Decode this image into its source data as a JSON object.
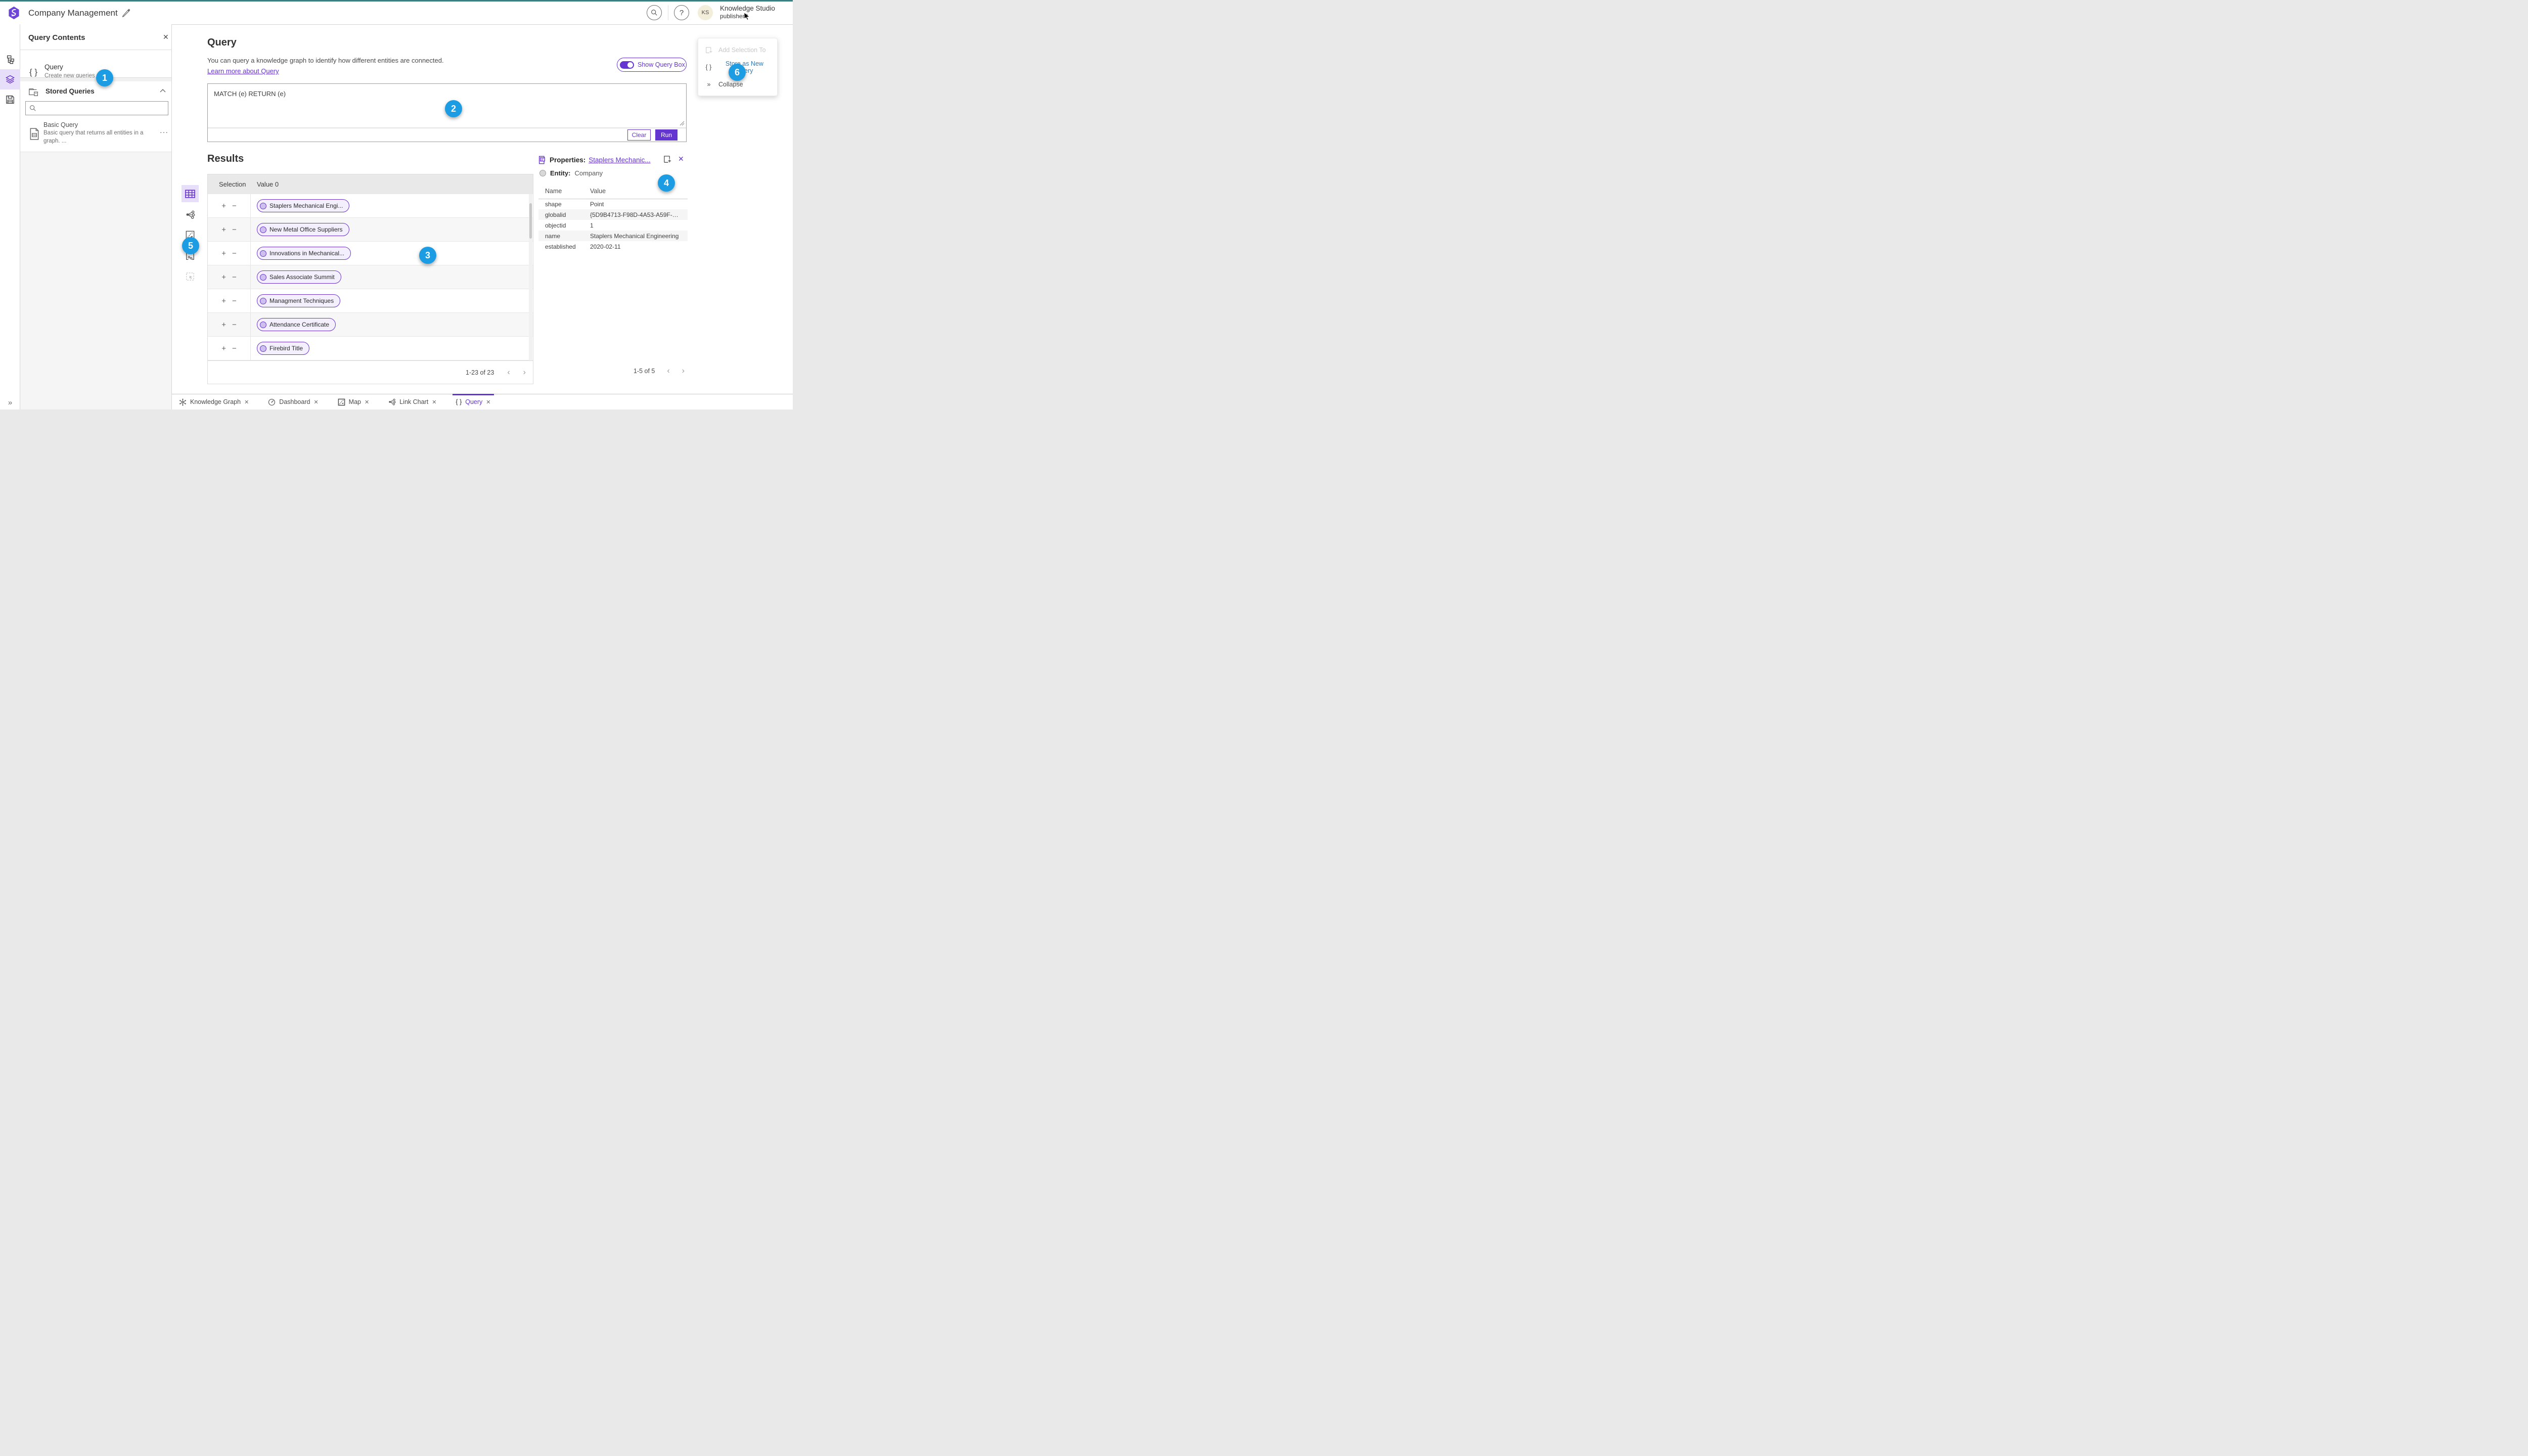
{
  "colors": {
    "accent": "#6535d2",
    "badge_blue": "#1b9ce3",
    "teal_strip": "#3b7f80",
    "link_blue": "#3178b6"
  },
  "glyphs": {
    "close": "✕",
    "plus": "+",
    "minus": "−",
    "prev": "‹",
    "next": "›",
    "ellipsis": "···",
    "braces": "{ }",
    "double_chevron": "»",
    "help": "?"
  },
  "header": {
    "app_title": "Company Management",
    "product_name": "Knowledge Studio",
    "user_name": "publisher2",
    "avatar_initials": "KS"
  },
  "query_contents": {
    "title": "Query Contents",
    "query_item": {
      "title": "Query",
      "subtitle": "Create new queries"
    },
    "stored_queries_label": "Stored Queries",
    "stored_item": {
      "title": "Basic Query",
      "desc_line1": "Basic query that returns all entities in a",
      "desc_line2": "graph. ..."
    }
  },
  "query_section": {
    "title": "Query",
    "description": "You can query a knowledge graph to identify how different entities are connected.",
    "learn_more": "Learn more about Query",
    "show_query_box": "Show Query Box",
    "query_text": "MATCH (e) RETURN (e)",
    "clear_label": "Clear",
    "run_label": "Run"
  },
  "results": {
    "title": "Results",
    "columns": [
      "Selection",
      "Value 0"
    ],
    "rows": [
      {
        "value": "Staplers Mechanical Engi..."
      },
      {
        "value": "New Metal Office Suppliers"
      },
      {
        "value": "Innovations in Mechanical..."
      },
      {
        "value": "Sales Associate Summit"
      },
      {
        "value": "Managment Techniques"
      },
      {
        "value": "Attendance Certificate"
      },
      {
        "value": "Firebird Title"
      }
    ],
    "pagination": {
      "range": "1-23 of 23"
    }
  },
  "properties": {
    "header_prefix": "Properties:",
    "entity_link": "Staplers Mechanic...",
    "entity_type_label": "Entity:",
    "entity_type": "Company",
    "columns": [
      "Name",
      "Value"
    ],
    "rows": [
      {
        "name": "shape",
        "value": "Point"
      },
      {
        "name": "globalid",
        "value": "{5D9B4713-F98D-4A53-A59F-C1..."
      },
      {
        "name": "objectid",
        "value": "1"
      },
      {
        "name": "name",
        "value": "Staplers Mechanical Engineering"
      },
      {
        "name": "established",
        "value": "2020-02-11"
      }
    ],
    "pagination": {
      "range": "1-5 of 5"
    }
  },
  "context_menu": {
    "items": [
      {
        "label": "Add Selection To"
      },
      {
        "label": "Store as New Query"
      },
      {
        "label": "Collapse"
      }
    ]
  },
  "tabs": [
    {
      "label": "Knowledge Graph"
    },
    {
      "label": "Dashboard"
    },
    {
      "label": "Map"
    },
    {
      "label": "Link Chart"
    },
    {
      "label": "Query"
    }
  ],
  "badges": [
    "1",
    "2",
    "3",
    "4",
    "5",
    "6"
  ]
}
